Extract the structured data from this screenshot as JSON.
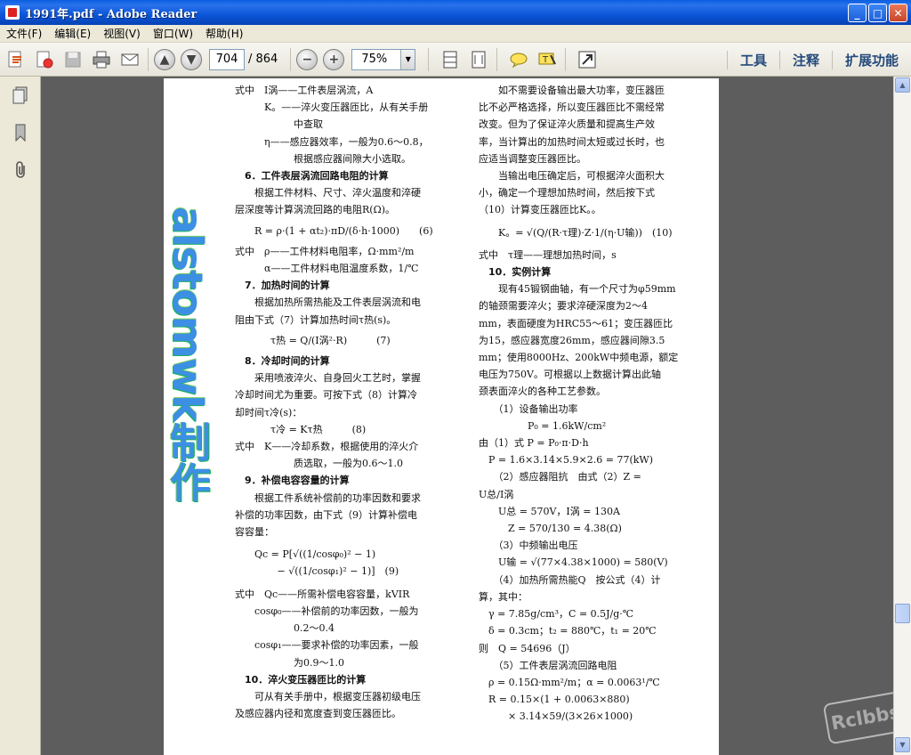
{
  "window": {
    "title": "1991年.pdf - Adobe Reader",
    "minimize": "_",
    "maximize": "□",
    "close": "✕"
  },
  "menu": {
    "file": "文件(F)",
    "edit": "编辑(E)",
    "view": "视图(V)",
    "window": "窗口(W)",
    "help": "帮助(H)"
  },
  "toolbar": {
    "page_current": "704",
    "page_total": "/ 864",
    "zoom": "75%",
    "tools": "工具",
    "comment": "注释",
    "extend": "扩展功能"
  },
  "watermark": {
    "text": "alstomwk制作",
    "stamp": "Rclbbs"
  },
  "doc": {
    "left": [
      "式中　I涡——工件表层涡流，A",
      "　　　K。——淬火变压器匝比，从有关手册",
      "　　　　　　中查取",
      "　　　η——感应器效率，一般为0.6～0.8，",
      "　　　　　　根据感应器间隙大小选取。",
      "　6．工件表层涡流回路电阻的计算",
      "　　根据工件材料、尺寸、淬火温度和淬硬",
      "层深度等计算涡流回路的电阻R(Ω)。",
      "R = ρ·(1 + αt₂)·πD/(δ·h·1000)　　(6)",
      "式中　ρ——工件材料电阻率，Ω·mm²/m",
      "　　　α——工件材料电阻温度系数，1/℃",
      "　7．加热时间的计算",
      "　　根据加热所需热能及工件表层涡流和电",
      "阻由下式（7）计算加热时间τ热(s)。",
      "τ热 = Q/(I涡²·R)　　　(7)",
      "　8．冷却时间的计算",
      "　　采用喷液淬火、自身回火工艺时，掌握",
      "冷却时间尤为重要。可按下式（8）计算冷",
      "却时间τ冷(s)：",
      "τ冷 = Kτ热　　　(8)",
      "式中　K——冷却系数，根据使用的淬火介",
      "　　　　　　质选取，一般为0.6～1.0",
      "　9．补偿电容容量的计算",
      "　　根据工件系统补偿前的功率因数和要求",
      "补偿的功率因数，由下式（9）计算补偿电",
      "容容量：",
      "Qc = P[√((1/cosφ₀)² − 1)",
      "　　 − √((1/cosφ₁)² − 1)]　(9)",
      "式中　Qc——所需补偿电容容量，kVIR",
      "　　cosφ₀——补偿前的功率因数，一般为",
      "　　　　　　0.2～0.4",
      "　　cosφ₁——要求补偿的功率因素，一般",
      "　　　　　　为0.9～1.0",
      "　10．淬火变压器匝比的计算",
      "　　可从有关手册中，根据变压器初级电压",
      "及感应器内径和宽度查到变压器匝比。"
    ],
    "right": [
      "　　如不需要设备输出最大功率，变压器匝",
      "比不必严格选择，所以变压器匝比不需经常",
      "改变。但为了保证淬火质量和提高生产效",
      "率，当计算出的加热时间太短或过长时，也",
      "应适当调整变压器匝比。",
      "　　当输出电压确定后，可根据淬火面积大",
      "小，确定一个理想加热时间，然后按下式",
      "（10）计算变压器匝比K。。",
      "K。= √(Q/(R·τ理)·Z·1/(η·U输))　(10)",
      "式中　τ理——理想加热时间，s",
      "　10．实例计算",
      "　　现有45锻钢曲轴，有一个尺寸为φ59mm",
      "的轴颈需要淬火；要求淬硬深度为2～4",
      "mm，表面硬度为HRC55～61；变压器匝比",
      "为15，感应器宽度26mm，感应器间隙3.5",
      "mm；使用8000Hz、200kW中频电源，额定",
      "电压为750V。可根据以上数据计算出此轴",
      "颈表面淬火的各种工艺参数。",
      "　　（1）设备输出功率",
      "　　　　　P₀ = 1.6kW/cm²",
      "由（1）式 P = P₀·π·D·h",
      "　P = 1.6×3.14×5.9×2.6 = 77(kW)",
      "　　（2）感应器阻抗　由式（2）Z =",
      "U总/I涡",
      "　　U总 = 570V，I涡 = 130A",
      "　　　Z = 570/130 = 4.38(Ω)",
      "　　（3）中频输出电压",
      "　　U输 = √(77×4.38×1000) = 580(V)",
      "　　（4）加热所需热能Q　按公式（4）计",
      "算，其中：",
      "　γ = 7.85g/cm³，C = 0.5J/g·℃",
      "　δ = 0.3cm；t₂ = 880℃，t₁ = 20℃",
      "则　Q = 54696（J）",
      "　　（5）工件表层涡流回路电阻",
      "　ρ = 0.15Ω·mm²/m；α = 0.0063¹/℃",
      "　R = 0.15×(1 + 0.0063×880)",
      "　　　× 3.14×59/(3×26×1000)"
    ]
  }
}
